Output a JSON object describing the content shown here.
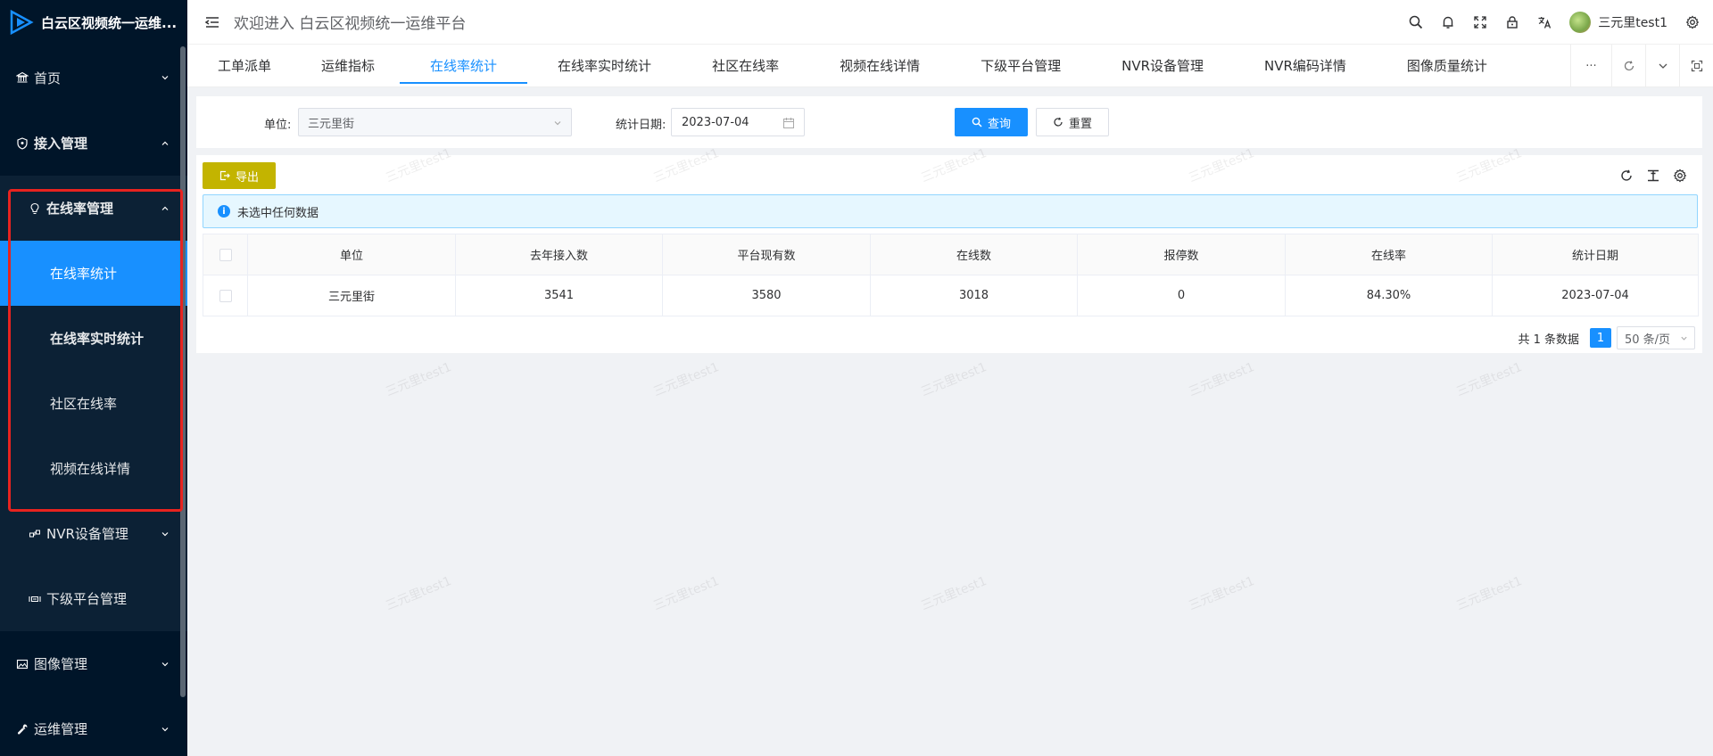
{
  "app": {
    "title": "白云区视频统一运维...",
    "welcome": "欢迎进入 白云区视频统一运维平台",
    "username": "三元里test1",
    "watermark": "三元里test1"
  },
  "colors": {
    "sidebar_bg": "#001529",
    "accent": "#1890ff",
    "export_btn": "#c3b400",
    "highlight": "#e8231f"
  },
  "sidebar": {
    "items": [
      {
        "label": "首页",
        "icon": "bank-icon"
      },
      {
        "label": "接入管理",
        "icon": "shield-icon"
      },
      {
        "label": "在线率管理",
        "icon": "bulb-icon"
      },
      {
        "label": "在线率统计"
      },
      {
        "label": "在线率实时统计"
      },
      {
        "label": "社区在线率"
      },
      {
        "label": "视频在线详情"
      },
      {
        "label": "NVR设备管理",
        "icon": "nodes-icon"
      },
      {
        "label": "下级平台管理",
        "icon": "gateway-icon"
      },
      {
        "label": "图像管理",
        "icon": "picture-icon"
      },
      {
        "label": "运维管理",
        "icon": "wrench-icon"
      }
    ]
  },
  "tabs": [
    {
      "label": "工单派单"
    },
    {
      "label": "运维指标"
    },
    {
      "label": "在线率统计",
      "active": true
    },
    {
      "label": "在线率实时统计"
    },
    {
      "label": "社区在线率"
    },
    {
      "label": "视频在线详情"
    },
    {
      "label": "下级平台管理"
    },
    {
      "label": "NVR设备管理"
    },
    {
      "label": "NVR编码详情"
    },
    {
      "label": "图像质量统计"
    }
  ],
  "tab_tools": {
    "more": "···"
  },
  "search": {
    "unit_label": "单位:",
    "unit_value": "三元里街",
    "date_label": "统计日期:",
    "date_value": "2023-07-04",
    "query_label": "查询",
    "reset_label": "重置"
  },
  "toolbar": {
    "export_label": "导出"
  },
  "alert": {
    "text": "未选中任何数据"
  },
  "table": {
    "columns": [
      "单位",
      "去年接入数",
      "平台现有数",
      "在线数",
      "报停数",
      "在线率",
      "统计日期"
    ],
    "rows": [
      [
        "三元里街",
        "3541",
        "3580",
        "3018",
        "0",
        "84.30%",
        "2023-07-04"
      ]
    ]
  },
  "pagination": {
    "total_text": "共 1 条数据",
    "current_page": "1",
    "page_size": "50 条/页"
  }
}
